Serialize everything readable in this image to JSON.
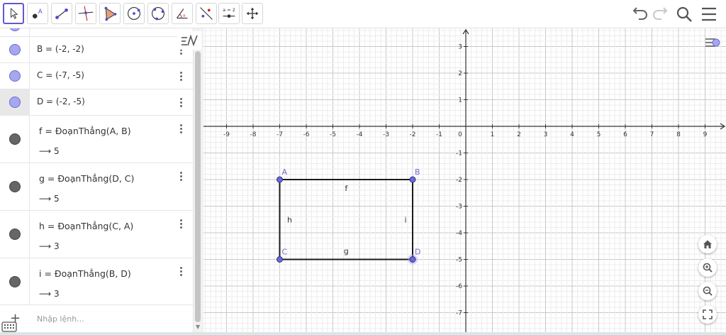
{
  "toolbar": {
    "tools": [
      {
        "name": "move-tool",
        "active": true
      },
      {
        "name": "point-tool"
      },
      {
        "name": "segment-tool"
      },
      {
        "name": "perpendicular-line-tool"
      },
      {
        "name": "polygon-tool"
      },
      {
        "name": "circle-tool"
      },
      {
        "name": "circle-through-3-points-tool"
      },
      {
        "name": "angle-tool"
      },
      {
        "name": "reflect-about-line-tool"
      },
      {
        "name": "slider-tool",
        "label": "a = 2"
      },
      {
        "name": "move-graphics-view-tool"
      }
    ],
    "right": [
      "undo-icon",
      "redo-icon",
      "search-icon",
      "menu-icon"
    ]
  },
  "algebra": {
    "items": [
      {
        "kind": "point",
        "text": "B = (-2, -2)"
      },
      {
        "kind": "point",
        "text": "C = (-7, -5)"
      },
      {
        "kind": "point",
        "text": "D = (-2, -5)",
        "selected": true
      },
      {
        "kind": "segment",
        "text": "f = ĐoạnThẳng(A, B)",
        "value": "⟶ 5"
      },
      {
        "kind": "segment",
        "text": "g = ĐoạnThẳng(D, C)",
        "value": "⟶ 5"
      },
      {
        "kind": "segment",
        "text": "h = ĐoạnThẳng(C, A)",
        "value": "⟶ 3"
      },
      {
        "kind": "segment",
        "text": "i = ĐoạnThẳng(B, D)",
        "value": "⟶ 3"
      }
    ],
    "input_placeholder": "Nhập lệnh..."
  },
  "graph": {
    "x_ticks": [
      "-9",
      "-8",
      "-7",
      "-6",
      "-5",
      "-4",
      "-3",
      "-2",
      "-1",
      "1",
      "2",
      "3",
      "4",
      "5",
      "6",
      "7",
      "8",
      "9"
    ],
    "y_ticks": [
      "3",
      "2",
      "1",
      "-1",
      "-2",
      "-3",
      "-4",
      "-5",
      "-6",
      "-7"
    ],
    "origin_label": "0",
    "points": [
      {
        "label": "A",
        "x": -7,
        "y": -2
      },
      {
        "label": "B",
        "x": -2,
        "y": -2
      },
      {
        "label": "C",
        "x": -7,
        "y": -5
      },
      {
        "label": "D",
        "x": -2,
        "y": -5
      }
    ],
    "segments": [
      {
        "label": "f",
        "from": "A",
        "to": "B"
      },
      {
        "label": "g",
        "from": "D",
        "to": "C"
      },
      {
        "label": "h",
        "from": "C",
        "to": "A"
      },
      {
        "label": "i",
        "from": "B",
        "to": "D"
      }
    ],
    "colors": {
      "point": "#6b6bd0",
      "point_fill": "#a7a7f0",
      "accent": "#6557d2"
    }
  },
  "graphics_buttons": [
    "home-icon",
    "zoom-in-icon",
    "zoom-out-icon",
    "fullscreen-icon"
  ]
}
